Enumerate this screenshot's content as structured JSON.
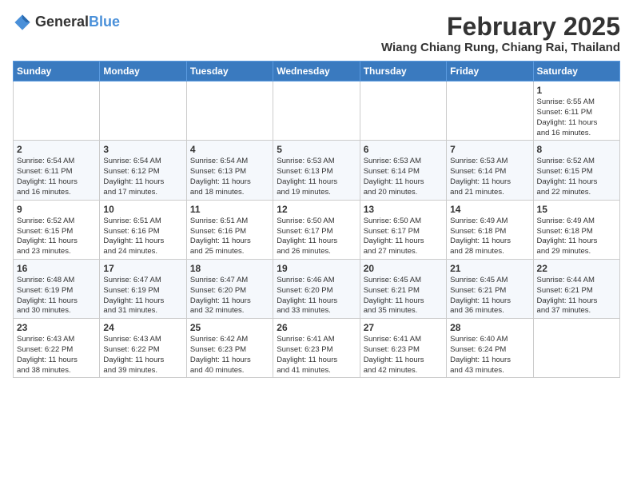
{
  "header": {
    "logo_general": "General",
    "logo_blue": "Blue",
    "month": "February 2025",
    "location": "Wiang Chiang Rung, Chiang Rai, Thailand"
  },
  "days_of_week": [
    "Sunday",
    "Monday",
    "Tuesday",
    "Wednesday",
    "Thursday",
    "Friday",
    "Saturday"
  ],
  "weeks": [
    [
      {
        "day": "",
        "info": ""
      },
      {
        "day": "",
        "info": ""
      },
      {
        "day": "",
        "info": ""
      },
      {
        "day": "",
        "info": ""
      },
      {
        "day": "",
        "info": ""
      },
      {
        "day": "",
        "info": ""
      },
      {
        "day": "1",
        "info": "Sunrise: 6:55 AM\nSunset: 6:11 PM\nDaylight: 11 hours\nand 16 minutes."
      }
    ],
    [
      {
        "day": "2",
        "info": "Sunrise: 6:54 AM\nSunset: 6:11 PM\nDaylight: 11 hours\nand 16 minutes."
      },
      {
        "day": "3",
        "info": "Sunrise: 6:54 AM\nSunset: 6:12 PM\nDaylight: 11 hours\nand 17 minutes."
      },
      {
        "day": "4",
        "info": "Sunrise: 6:54 AM\nSunset: 6:13 PM\nDaylight: 11 hours\nand 18 minutes."
      },
      {
        "day": "5",
        "info": "Sunrise: 6:53 AM\nSunset: 6:13 PM\nDaylight: 11 hours\nand 19 minutes."
      },
      {
        "day": "6",
        "info": "Sunrise: 6:53 AM\nSunset: 6:14 PM\nDaylight: 11 hours\nand 20 minutes."
      },
      {
        "day": "7",
        "info": "Sunrise: 6:53 AM\nSunset: 6:14 PM\nDaylight: 11 hours\nand 21 minutes."
      },
      {
        "day": "8",
        "info": "Sunrise: 6:52 AM\nSunset: 6:15 PM\nDaylight: 11 hours\nand 22 minutes."
      }
    ],
    [
      {
        "day": "9",
        "info": "Sunrise: 6:52 AM\nSunset: 6:15 PM\nDaylight: 11 hours\nand 23 minutes."
      },
      {
        "day": "10",
        "info": "Sunrise: 6:51 AM\nSunset: 6:16 PM\nDaylight: 11 hours\nand 24 minutes."
      },
      {
        "day": "11",
        "info": "Sunrise: 6:51 AM\nSunset: 6:16 PM\nDaylight: 11 hours\nand 25 minutes."
      },
      {
        "day": "12",
        "info": "Sunrise: 6:50 AM\nSunset: 6:17 PM\nDaylight: 11 hours\nand 26 minutes."
      },
      {
        "day": "13",
        "info": "Sunrise: 6:50 AM\nSunset: 6:17 PM\nDaylight: 11 hours\nand 27 minutes."
      },
      {
        "day": "14",
        "info": "Sunrise: 6:49 AM\nSunset: 6:18 PM\nDaylight: 11 hours\nand 28 minutes."
      },
      {
        "day": "15",
        "info": "Sunrise: 6:49 AM\nSunset: 6:18 PM\nDaylight: 11 hours\nand 29 minutes."
      }
    ],
    [
      {
        "day": "16",
        "info": "Sunrise: 6:48 AM\nSunset: 6:19 PM\nDaylight: 11 hours\nand 30 minutes."
      },
      {
        "day": "17",
        "info": "Sunrise: 6:47 AM\nSunset: 6:19 PM\nDaylight: 11 hours\nand 31 minutes."
      },
      {
        "day": "18",
        "info": "Sunrise: 6:47 AM\nSunset: 6:20 PM\nDaylight: 11 hours\nand 32 minutes."
      },
      {
        "day": "19",
        "info": "Sunrise: 6:46 AM\nSunset: 6:20 PM\nDaylight: 11 hours\nand 33 minutes."
      },
      {
        "day": "20",
        "info": "Sunrise: 6:45 AM\nSunset: 6:21 PM\nDaylight: 11 hours\nand 35 minutes."
      },
      {
        "day": "21",
        "info": "Sunrise: 6:45 AM\nSunset: 6:21 PM\nDaylight: 11 hours\nand 36 minutes."
      },
      {
        "day": "22",
        "info": "Sunrise: 6:44 AM\nSunset: 6:21 PM\nDaylight: 11 hours\nand 37 minutes."
      }
    ],
    [
      {
        "day": "23",
        "info": "Sunrise: 6:43 AM\nSunset: 6:22 PM\nDaylight: 11 hours\nand 38 minutes."
      },
      {
        "day": "24",
        "info": "Sunrise: 6:43 AM\nSunset: 6:22 PM\nDaylight: 11 hours\nand 39 minutes."
      },
      {
        "day": "25",
        "info": "Sunrise: 6:42 AM\nSunset: 6:23 PM\nDaylight: 11 hours\nand 40 minutes."
      },
      {
        "day": "26",
        "info": "Sunrise: 6:41 AM\nSunset: 6:23 PM\nDaylight: 11 hours\nand 41 minutes."
      },
      {
        "day": "27",
        "info": "Sunrise: 6:41 AM\nSunset: 6:23 PM\nDaylight: 11 hours\nand 42 minutes."
      },
      {
        "day": "28",
        "info": "Sunrise: 6:40 AM\nSunset: 6:24 PM\nDaylight: 11 hours\nand 43 minutes."
      },
      {
        "day": "",
        "info": ""
      }
    ]
  ]
}
